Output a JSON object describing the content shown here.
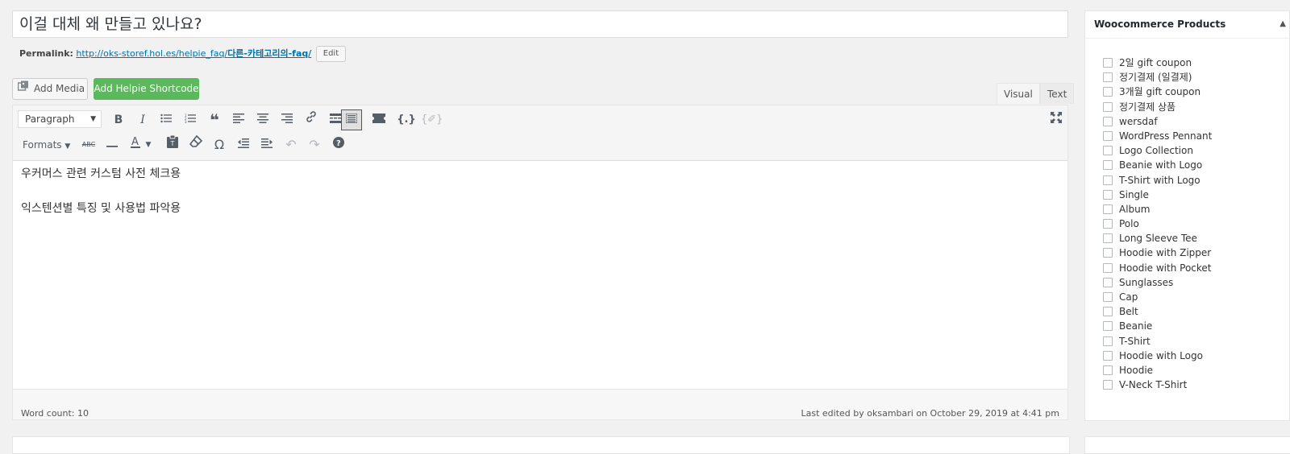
{
  "post": {
    "title": "이걸 대체 왜 만들고 있나요?",
    "permalink_label": "Permalink:",
    "permalink_base": "http://oks-storef.hol.es/helpie_faq/",
    "permalink_slug": "다른-카테고리의-faq/",
    "edit_label": "Edit"
  },
  "media": {
    "add_media_label": "Add Media",
    "add_helpie_label": "Add Helpie Shortcode"
  },
  "tabs": {
    "visual": "Visual",
    "text": "Text"
  },
  "toolbar": {
    "format_value": "Paragraph",
    "formats_label": "Formats",
    "icons": [
      "bold-icon",
      "italic-icon",
      "bulleted-list-icon",
      "numbered-list-icon",
      "blockquote-icon",
      "align-left-icon",
      "align-center-icon",
      "align-right-icon",
      "link-icon",
      "read-more-icon",
      "toolbar-toggle-icon",
      "shortcode-icon",
      "code-braces-icon",
      "clear-format-icon",
      "fullscreen-icon"
    ]
  },
  "content": {
    "paragraphs": [
      "우커머스 관련 커스텀 사전 체크용",
      "익스텐션별 특징 및 사용법 파악용"
    ]
  },
  "status": {
    "word_count": "Word count: 10",
    "last_edited": "Last edited by oksambari on October 29, 2019 at 4:41 pm"
  },
  "sidebar": {
    "title": "Woocommerce Products",
    "products": [
      "2일 gift coupon",
      "정기결제 (일결제)",
      "3개월 gift coupon",
      "정기결제 상품",
      "wersdaf",
      "WordPress Pennant",
      "Logo Collection",
      "Beanie with Logo",
      "T-Shirt with Logo",
      "Single",
      "Album",
      "Polo",
      "Long Sleeve Tee",
      "Hoodie with Zipper",
      "Hoodie with Pocket",
      "Sunglasses",
      "Cap",
      "Belt",
      "Beanie",
      "T-Shirt",
      "Hoodie with Logo",
      "Hoodie",
      "V-Neck T-Shirt"
    ]
  }
}
